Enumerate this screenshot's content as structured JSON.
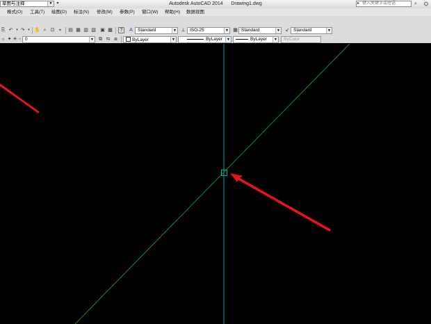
{
  "workspace": {
    "selected": "草图与注释"
  },
  "title": {
    "app": "Autodesk AutoCAD 2014",
    "file": "Drawing1.dwg"
  },
  "search": {
    "placeholder": "键入关键字或短语"
  },
  "menu": {
    "items": [
      "格式(O)",
      "工具(T)",
      "绘图(D)",
      "标注(N)",
      "修改(M)",
      "参数(P)",
      "窗口(W)",
      "帮助(H)",
      "数据视图"
    ]
  },
  "styles": {
    "text_style": "Standard",
    "dim_style": "ISO-25",
    "table_style": "Standard",
    "multileader_style": "Standard"
  },
  "layers": {
    "current": "0"
  },
  "properties": {
    "color": "ByLayer",
    "linetype": "ByLayer",
    "lineweight": "ByLayer",
    "plotstyle": "ByColor"
  },
  "colors": {
    "canvas": "#000000",
    "xline_vertical": "#00a6a6",
    "xline_diagonal": "#1f8a2a",
    "annotation_arrow": "#e8141b"
  },
  "icons": [
    "undo-icon",
    "redo-icon",
    "pan-icon",
    "zoom-realtime-icon",
    "zoom-window-icon",
    "zoom-previous-icon",
    "properties-icon",
    "design-center-icon",
    "tool-palettes-icon",
    "sheet-set-icon",
    "markup-icon",
    "calc-icon",
    "help-icon"
  ]
}
